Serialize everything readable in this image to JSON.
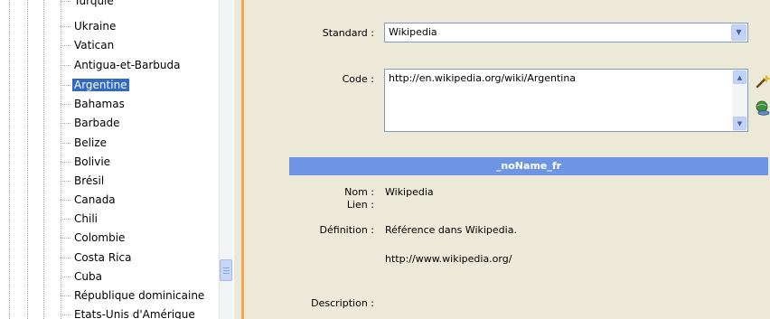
{
  "tree": {
    "items": [
      {
        "label": "Turquie"
      },
      {
        "label": "Ukraine"
      },
      {
        "label": "Vatican"
      },
      {
        "label": "Antigua-et-Barbuda"
      },
      {
        "label": "Argentine",
        "selected": true
      },
      {
        "label": "Bahamas"
      },
      {
        "label": "Barbade"
      },
      {
        "label": "Belize"
      },
      {
        "label": "Bolivie"
      },
      {
        "label": "Brésil"
      },
      {
        "label": "Canada"
      },
      {
        "label": "Chili"
      },
      {
        "label": "Colombie"
      },
      {
        "label": "Costa Rica"
      },
      {
        "label": "Cuba"
      },
      {
        "label": "République dominicaine"
      },
      {
        "label": "Etats-Unis d'Amérique"
      }
    ]
  },
  "detail": {
    "standard_label": "Standard :",
    "standard_value": "Wikipedia",
    "code_label": "Code :",
    "code_value": "http://en.wikipedia.org/wiki/Argentina",
    "section_title": "_noName_fr",
    "nom_label": "Nom :",
    "nom_value": "Wikipedia",
    "lien_label": "Lien :",
    "definition_label": "Définition :",
    "definition_value": "Référence dans Wikipedia.",
    "definition_url": "http://www.wikipedia.org/",
    "description_label": "Description :"
  },
  "colors": {
    "selection": "#316ac5",
    "section_header": "#6e95e3",
    "splitter_accent": "#f7a44d",
    "panel_bg": "#ece9d8"
  },
  "icons": {
    "wand": "magic-wand-icon",
    "web": "web-link-icon",
    "dropdown": "chevron-down-icon"
  }
}
